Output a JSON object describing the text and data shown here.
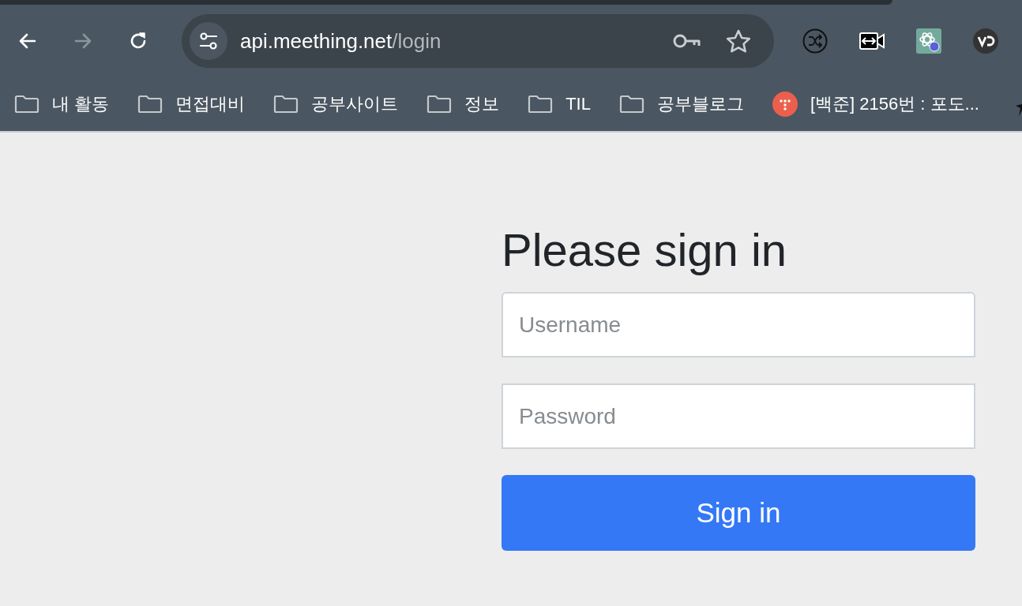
{
  "browser": {
    "url": {
      "host": "api.meething.net",
      "path": "/login"
    },
    "bookmarks": [
      {
        "kind": "folder",
        "label": "내 활동"
      },
      {
        "kind": "folder",
        "label": "면접대비"
      },
      {
        "kind": "folder",
        "label": "공부사이트"
      },
      {
        "kind": "folder",
        "label": "정보"
      },
      {
        "kind": "folder",
        "label": "TIL"
      },
      {
        "kind": "folder",
        "label": "공부블로그"
      },
      {
        "kind": "site",
        "label": "[백준] 2156번 : 포도..."
      },
      {
        "kind": "runner"
      }
    ]
  },
  "login": {
    "title": "Please sign in",
    "fields": [
      {
        "kind": "text",
        "placeholder": "Username"
      },
      {
        "kind": "password",
        "placeholder": "Password"
      }
    ],
    "button": "Sign in"
  }
}
